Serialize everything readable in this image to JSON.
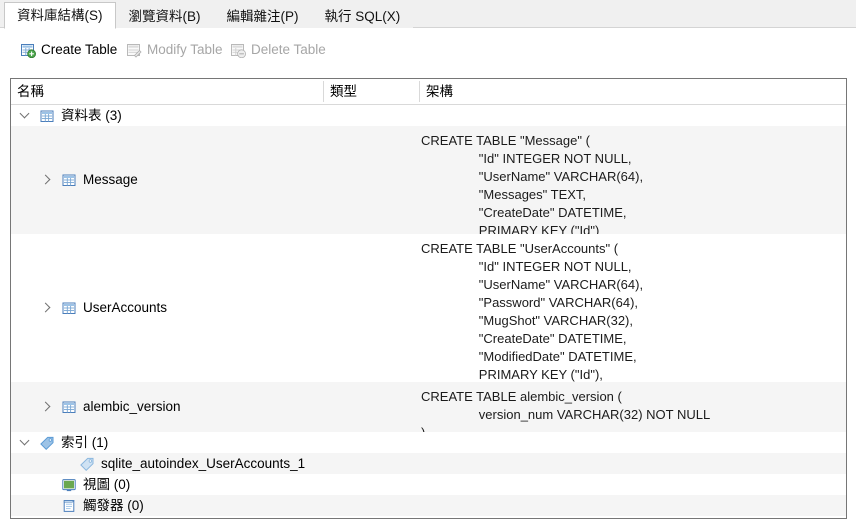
{
  "tabs": [
    {
      "label": "資料庫結構(S)",
      "active": true
    },
    {
      "label": "瀏覽資料(B)",
      "active": false
    },
    {
      "label": "編輯雜注(P)",
      "active": false
    },
    {
      "label": "執行 SQL(X)",
      "active": false
    }
  ],
  "toolbar": {
    "create_table": "Create Table",
    "modify_table": "Modify Table",
    "delete_table": "Delete Table"
  },
  "columns": {
    "name": "名稱",
    "type": "類型",
    "schema": "架構"
  },
  "tree": {
    "tables_group": "資料表 (3)",
    "indices_group": "索引 (1)",
    "views_group": "視圖 (0)",
    "triggers_group": "觸發器 (0)",
    "index_item": "sqlite_autoindex_UserAccounts_1",
    "items": [
      {
        "name": "Message",
        "schema": "CREATE TABLE \"Message\" (\n\t\"Id\" INTEGER NOT NULL,\n\t\"UserName\" VARCHAR(64),\n\t\"Messages\" TEXT,\n\t\"CreateDate\" DATETIME,\n\tPRIMARY KEY (\"Id\")\n)"
      },
      {
        "name": "UserAccounts",
        "schema": "CREATE TABLE \"UserAccounts\" (\n\t\"Id\" INTEGER NOT NULL,\n\t\"UserName\" VARCHAR(64),\n\t\"Password\" VARCHAR(64),\n\t\"MugShot\" VARCHAR(32),\n\t\"CreateDate\" DATETIME,\n\t\"ModifiedDate\" DATETIME,\n\tPRIMARY KEY (\"Id\"),\n\tUNIQUE (\"UserName\")\n)"
      },
      {
        "name": "alembic_version",
        "schema": "CREATE TABLE alembic_version (\n\tversion_num VARCHAR(32) NOT NULL\n)"
      }
    ]
  },
  "colors": {
    "alt_row": "#f5f5f5",
    "panel_border": "#767676",
    "tab_active_bg": "#ffffff",
    "tabbar_bg": "#f0f0f0",
    "disabled_text": "#a6a6a6",
    "table_icon_blue": "#4a7ebb",
    "plus_badge_green": "#4ca64c",
    "index_tag_blue": "#5b9bd5"
  }
}
